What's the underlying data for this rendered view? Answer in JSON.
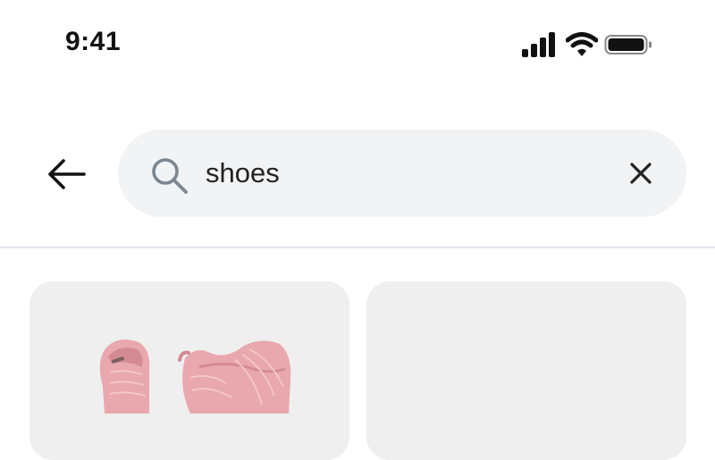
{
  "status_bar": {
    "time": "9:41",
    "icons": [
      "cellular-signal-icon",
      "wifi-icon",
      "battery-icon"
    ]
  },
  "search": {
    "value": "shoes",
    "icons": {
      "back": "arrow-left-icon",
      "search": "search-icon",
      "clear": "close-icon"
    }
  },
  "results": [
    {
      "image": "pink-sneakers"
    },
    {
      "image": ""
    }
  ],
  "colors": {
    "search_background": "#f1f3f5",
    "card_background": "#efefef",
    "divider": "#e1e6ee",
    "sneaker_pink": "#e8a8ae"
  }
}
